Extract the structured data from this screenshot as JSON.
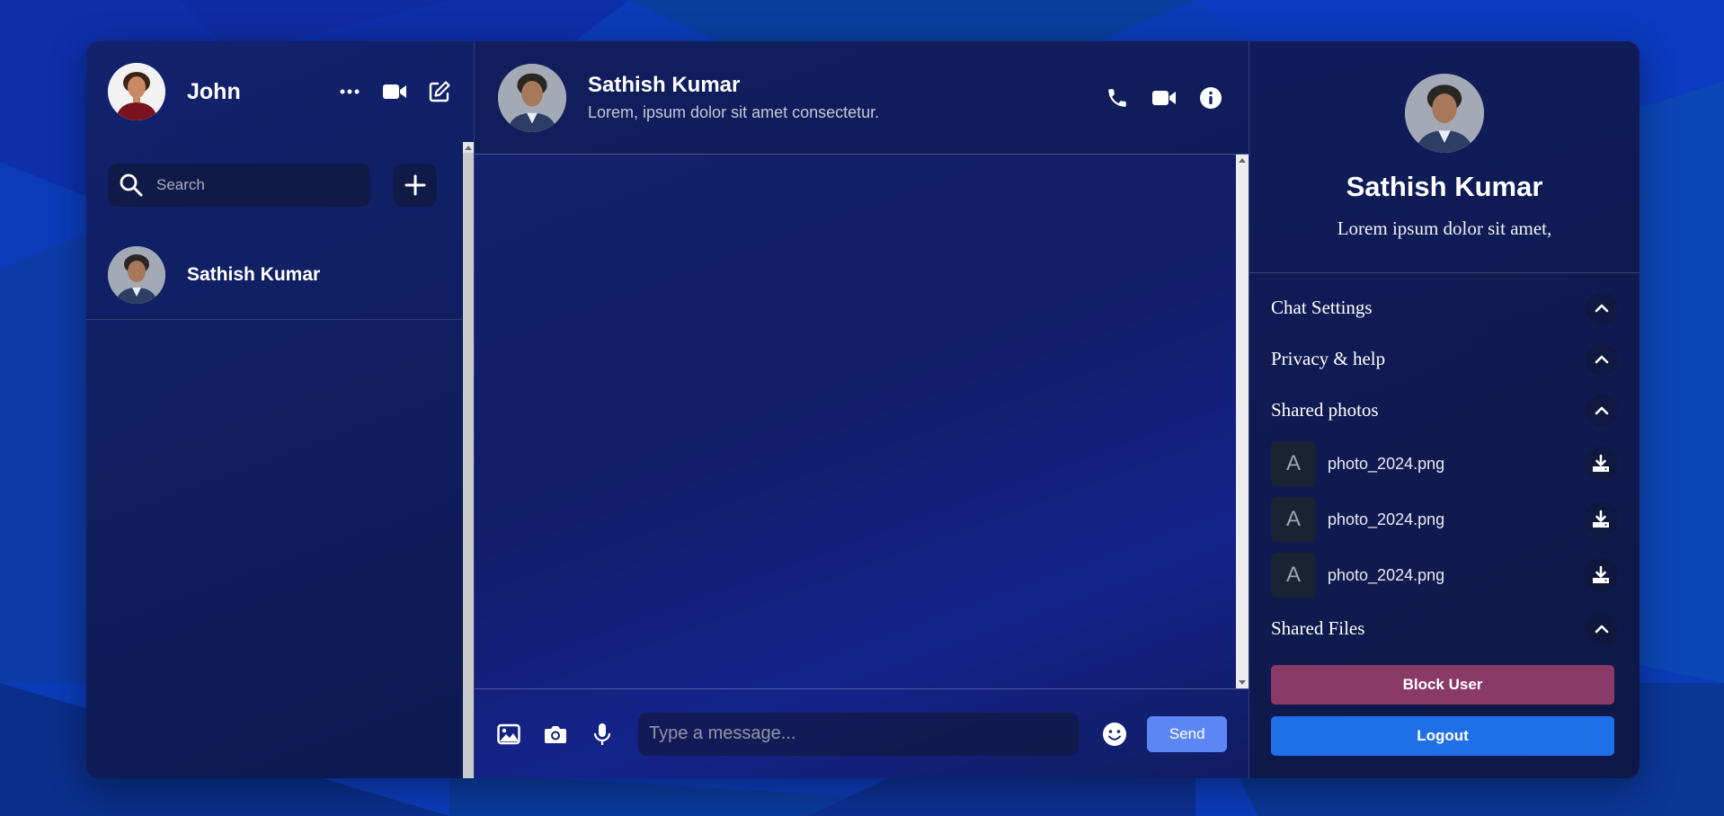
{
  "current_user": {
    "name": "John"
  },
  "search": {
    "placeholder": "Search"
  },
  "contacts": [
    {
      "name": "Sathish Kumar"
    }
  ],
  "chat": {
    "name": "Sathish Kumar",
    "status": "Lorem, ipsum dolor sit amet consectetur.",
    "composer_placeholder": "Type a message...",
    "send_label": "Send"
  },
  "details": {
    "name": "Sathish Kumar",
    "bio": "Lorem ipsum dolor sit amet,",
    "sections": {
      "chat_settings": "Chat Settings",
      "privacy_help": "Privacy & help",
      "shared_photos": "Shared photos",
      "shared_files": "Shared Files"
    },
    "photos": [
      {
        "thumb": "A",
        "name": "photo_2024.png"
      },
      {
        "thumb": "A",
        "name": "photo_2024.png"
      },
      {
        "thumb": "A",
        "name": "photo_2024.png"
      }
    ],
    "block_label": "Block User",
    "logout_label": "Logout"
  },
  "colors": {
    "send": "#5d86f5",
    "block": "#8a3a68",
    "logout": "#1f6fe8"
  },
  "icons": {
    "header": [
      "more-icon",
      "video-icon",
      "edit-icon"
    ],
    "chat_actions": [
      "phone-icon",
      "video-icon",
      "info-icon"
    ],
    "composer": [
      "image-icon",
      "camera-icon",
      "microphone-icon",
      "emoji-icon"
    ]
  }
}
